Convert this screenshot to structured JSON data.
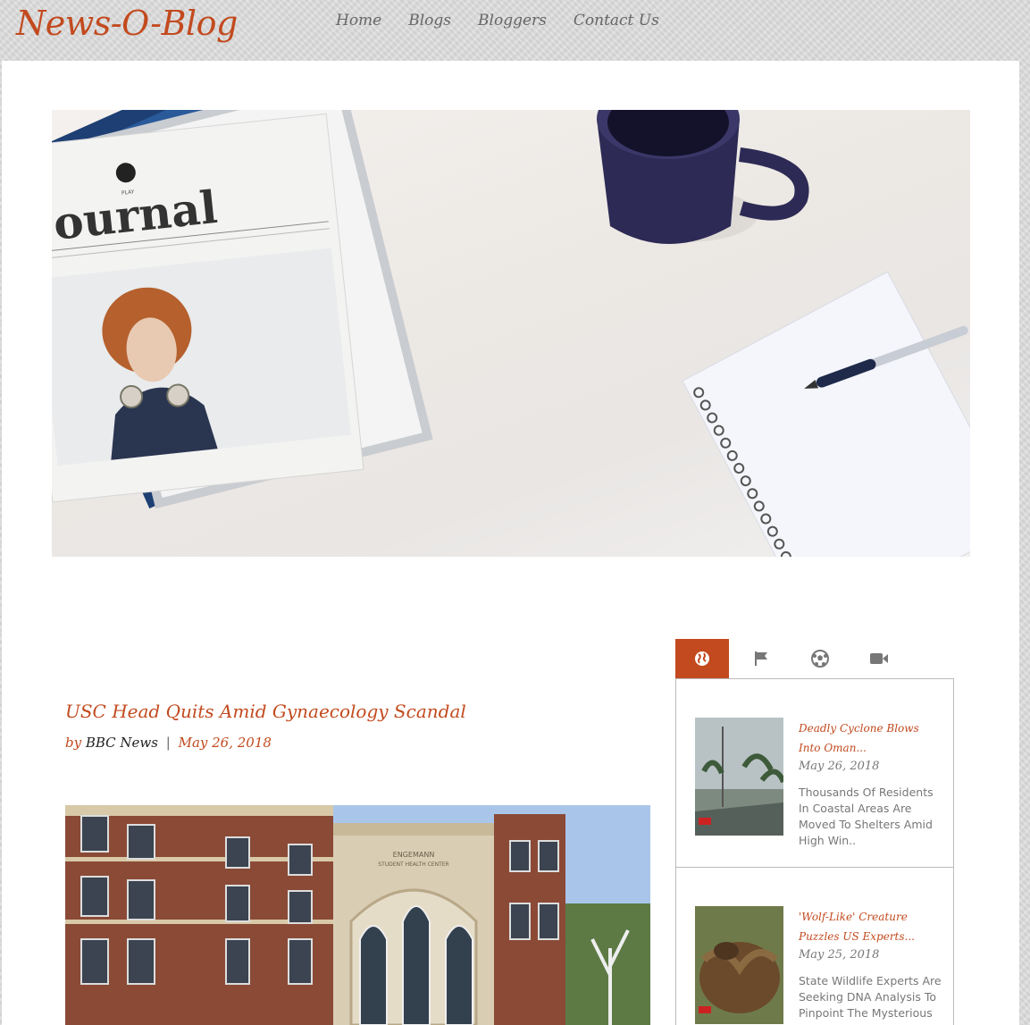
{
  "site": {
    "logo": "News-O-Blog"
  },
  "nav": {
    "items": [
      "Home",
      "Blogs",
      "Bloggers",
      "Contact Us"
    ]
  },
  "hero": {
    "newspaper_masthead": "Journal",
    "newspaper_label": "PLAY"
  },
  "article": {
    "title": "USC Head Quits Amid Gynaecology Scandal",
    "by_label": "by",
    "author": "BBC News",
    "separator": "|",
    "date": "May 26, 2018",
    "building_sign_line1": "ENGEMANN",
    "building_sign_line2": "STUDENT HEALTH CENTER"
  },
  "sidebar": {
    "tabs": [
      {
        "icon": "globe-icon",
        "active": true
      },
      {
        "icon": "flag-icon",
        "active": false
      },
      {
        "icon": "soccer-ball-icon",
        "active": false
      },
      {
        "icon": "video-camera-icon",
        "active": false
      }
    ],
    "posts": [
      {
        "title": "Deadly Cyclone Blows Into Oman...",
        "date": "May 26, 2018",
        "excerpt": "Thousands Of Residents In Coastal Areas Are Moved To Shelters Amid High Win.."
      },
      {
        "title": "'Wolf-Like' Creature Puzzles US Experts...",
        "date": "May 25, 2018",
        "excerpt": "State Wildlife Experts Are Seeking DNA Analysis To Pinpoint The Mysterious"
      }
    ]
  },
  "colors": {
    "accent": "#c24a1e",
    "nav_text": "#666666",
    "muted_text": "#777777"
  }
}
